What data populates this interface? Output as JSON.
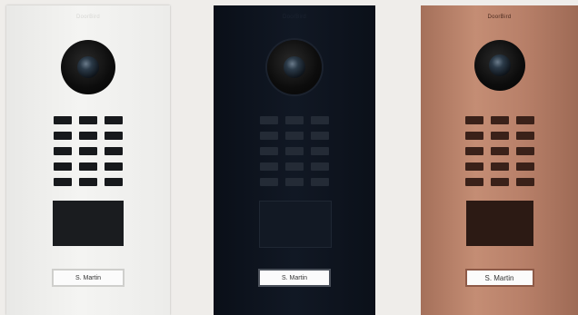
{
  "brand_label": "DoorBird",
  "colors": {
    "background": "#efedea",
    "panel_white": "#f0f0ee",
    "panel_black": "#0e141e",
    "panel_bronze": "#b88069"
  },
  "panels": [
    {
      "finish": "white",
      "nameplate": "S. Martin"
    },
    {
      "finish": "black",
      "nameplate": "S. Martin"
    },
    {
      "finish": "bronze",
      "nameplate": "S. Martin"
    }
  ]
}
